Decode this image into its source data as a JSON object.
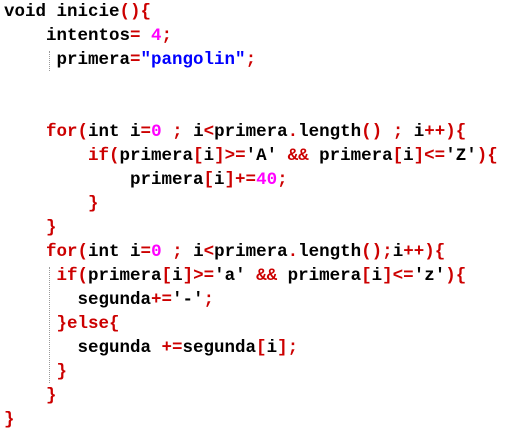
{
  "colors": {
    "text": "#000000",
    "symbol": "#cc0000",
    "number": "#ff00ff",
    "string": "#0000ff",
    "guide": "#9a9a9a",
    "background": "#ffffff"
  },
  "code": {
    "lines": [
      {
        "indent": 0,
        "tokens": [
          {
            "t": "void inicie",
            "k": "text"
          },
          {
            "t": "(){",
            "k": "symbol"
          }
        ]
      },
      {
        "indent": 4,
        "tokens": [
          {
            "t": "intentos",
            "k": "text"
          },
          {
            "t": "= ",
            "k": "symbol"
          },
          {
            "t": "4",
            "k": "number"
          },
          {
            "t": ";",
            "k": "symbol"
          }
        ]
      },
      {
        "indent": 5,
        "tokens": [
          {
            "t": "primera",
            "k": "text"
          },
          {
            "t": "=",
            "k": "symbol"
          },
          {
            "t": "\"pangolin\"",
            "k": "string"
          },
          {
            "t": ";",
            "k": "symbol"
          }
        ]
      },
      {
        "indent": 0,
        "tokens": []
      },
      {
        "indent": 0,
        "tokens": []
      },
      {
        "indent": 4,
        "tokens": [
          {
            "t": "for",
            "k": "symbol"
          },
          {
            "t": "(",
            "k": "symbol"
          },
          {
            "t": "int i",
            "k": "text"
          },
          {
            "t": "=",
            "k": "symbol"
          },
          {
            "t": "0",
            "k": "number"
          },
          {
            "t": " ; ",
            "k": "symbol"
          },
          {
            "t": "i",
            "k": "text"
          },
          {
            "t": "<",
            "k": "symbol"
          },
          {
            "t": "primera",
            "k": "text"
          },
          {
            "t": ".",
            "k": "symbol"
          },
          {
            "t": "length",
            "k": "text"
          },
          {
            "t": "()",
            "k": "symbol"
          },
          {
            "t": " ; ",
            "k": "symbol"
          },
          {
            "t": "i",
            "k": "text"
          },
          {
            "t": "++){",
            "k": "symbol"
          }
        ]
      },
      {
        "indent": 8,
        "tokens": [
          {
            "t": "if",
            "k": "symbol"
          },
          {
            "t": "(",
            "k": "symbol"
          },
          {
            "t": "primera",
            "k": "text"
          },
          {
            "t": "[",
            "k": "symbol"
          },
          {
            "t": "i",
            "k": "text"
          },
          {
            "t": "]>=",
            "k": "symbol"
          },
          {
            "t": "'A'",
            "k": "text"
          },
          {
            "t": " && ",
            "k": "symbol"
          },
          {
            "t": "primera",
            "k": "text"
          },
          {
            "t": "[",
            "k": "symbol"
          },
          {
            "t": "i",
            "k": "text"
          },
          {
            "t": "]<=",
            "k": "symbol"
          },
          {
            "t": "'Z'",
            "k": "text"
          },
          {
            "t": "){",
            "k": "symbol"
          }
        ]
      },
      {
        "indent": 12,
        "tokens": [
          {
            "t": "primera",
            "k": "text"
          },
          {
            "t": "[",
            "k": "symbol"
          },
          {
            "t": "i",
            "k": "text"
          },
          {
            "t": "]+=",
            "k": "symbol"
          },
          {
            "t": "40",
            "k": "number"
          },
          {
            "t": ";",
            "k": "symbol"
          }
        ]
      },
      {
        "indent": 8,
        "tokens": [
          {
            "t": "}",
            "k": "symbol"
          }
        ]
      },
      {
        "indent": 4,
        "tokens": [
          {
            "t": "}",
            "k": "symbol"
          }
        ]
      },
      {
        "indent": 4,
        "tokens": [
          {
            "t": "for",
            "k": "symbol"
          },
          {
            "t": "(",
            "k": "symbol"
          },
          {
            "t": "int i",
            "k": "text"
          },
          {
            "t": "=",
            "k": "symbol"
          },
          {
            "t": "0",
            "k": "number"
          },
          {
            "t": " ; ",
            "k": "symbol"
          },
          {
            "t": "i",
            "k": "text"
          },
          {
            "t": "<",
            "k": "symbol"
          },
          {
            "t": "primera",
            "k": "text"
          },
          {
            "t": ".",
            "k": "symbol"
          },
          {
            "t": "length",
            "k": "text"
          },
          {
            "t": "();",
            "k": "symbol"
          },
          {
            "t": "i",
            "k": "text"
          },
          {
            "t": "++){",
            "k": "symbol"
          }
        ]
      },
      {
        "indent": 5,
        "tokens": [
          {
            "t": "if",
            "k": "symbol"
          },
          {
            "t": "(",
            "k": "symbol"
          },
          {
            "t": "primera",
            "k": "text"
          },
          {
            "t": "[",
            "k": "symbol"
          },
          {
            "t": "i",
            "k": "text"
          },
          {
            "t": "]>=",
            "k": "symbol"
          },
          {
            "t": "'a'",
            "k": "text"
          },
          {
            "t": " && ",
            "k": "symbol"
          },
          {
            "t": "primera",
            "k": "text"
          },
          {
            "t": "[",
            "k": "symbol"
          },
          {
            "t": "i",
            "k": "text"
          },
          {
            "t": "]<=",
            "k": "symbol"
          },
          {
            "t": "'z'",
            "k": "text"
          },
          {
            "t": "){",
            "k": "symbol"
          }
        ]
      },
      {
        "indent": 7,
        "tokens": [
          {
            "t": "segunda",
            "k": "text"
          },
          {
            "t": "+=",
            "k": "symbol"
          },
          {
            "t": "'-'",
            "k": "text"
          },
          {
            "t": ";",
            "k": "symbol"
          }
        ]
      },
      {
        "indent": 5,
        "tokens": [
          {
            "t": "}else{",
            "k": "symbol"
          }
        ]
      },
      {
        "indent": 7,
        "tokens": [
          {
            "t": "segunda ",
            "k": "text"
          },
          {
            "t": "+=",
            "k": "symbol"
          },
          {
            "t": "segunda",
            "k": "text"
          },
          {
            "t": "[",
            "k": "symbol"
          },
          {
            "t": "i",
            "k": "text"
          },
          {
            "t": "];",
            "k": "symbol"
          }
        ]
      },
      {
        "indent": 5,
        "tokens": [
          {
            "t": "}",
            "k": "symbol"
          }
        ]
      },
      {
        "indent": 4,
        "tokens": [
          {
            "t": "}",
            "k": "symbol"
          }
        ]
      },
      {
        "indent": 0,
        "tokens": [
          {
            "t": "}",
            "k": "symbol"
          }
        ]
      }
    ]
  }
}
